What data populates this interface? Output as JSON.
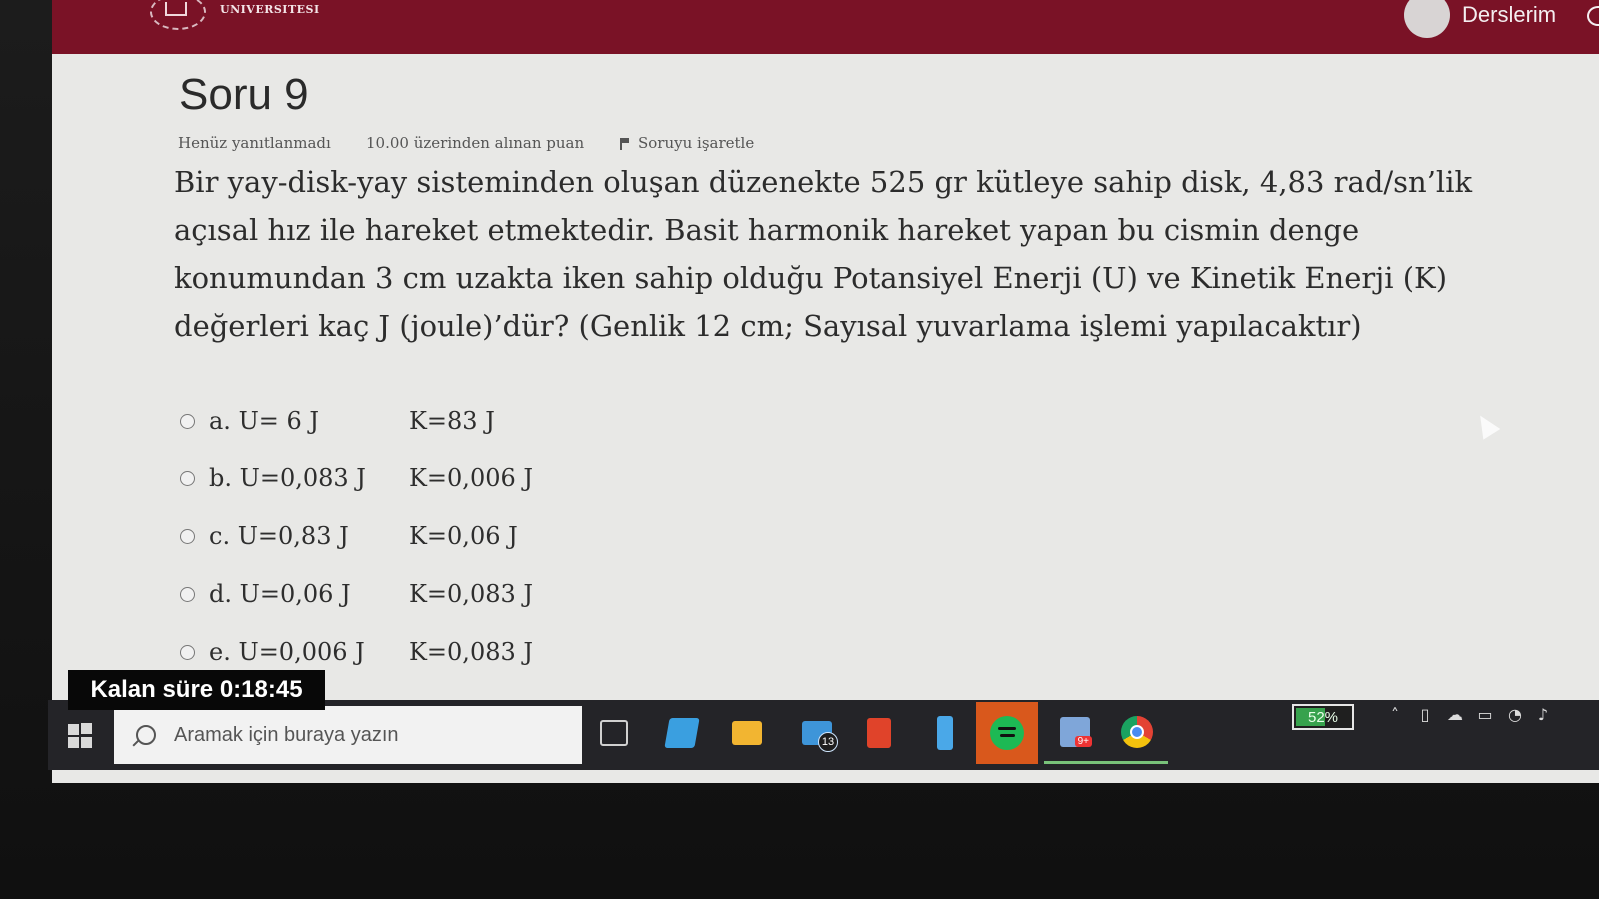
{
  "header": {
    "logo_text": "UNIVERSITESI",
    "nav_link": "Derslerim"
  },
  "question": {
    "title": "Soru 9",
    "state": "Henüz yanıtlanmadı",
    "grade": "10.00 üzerinden alınan puan",
    "flag": "Soruyu işaretle",
    "text": "Bir yay-disk-yay sisteminden oluşan düzenekte 525 gr kütleye sahip disk, 4,83 rad/sn’lik açısal hız ile hareket etmektedir. Basit harmonik hareket yapan bu cismin denge konumundan 3 cm uzakta iken sahip olduğu Potansiyel Enerji (U) ve Kinetik Enerji (K) değerleri kaç J (joule)’dür? (Genlik 12 cm; Sayısal yuvarlama işlemi yapılacaktır)",
    "answers": [
      {
        "u": "a. U= 6 J",
        "k": "K=83 J"
      },
      {
        "u": "b. U=0,083 J",
        "k": "K=0,006 J"
      },
      {
        "u": "c. U=0,83 J",
        "k": "K=0,06 J"
      },
      {
        "u": "d. U=0,06 J",
        "k": "K=0,083 J"
      },
      {
        "u": "e. U=0,006 J",
        "k": "K=0,083 J"
      }
    ]
  },
  "timer": {
    "text": "Kalan süre 0:18:45"
  },
  "taskbar": {
    "search_placeholder": "Aramak için buraya yazın",
    "mail_badge": "13",
    "app_badge": "9+",
    "battery_percent": "52%",
    "battery_level": 0.52,
    "icons": [
      "windows-start-icon",
      "task-view-icon",
      "file-explorer-icon",
      "folder-icon",
      "mail-icon",
      "office-icon",
      "phone-icon",
      "spotify-icon",
      "photos-icon",
      "chrome-icon",
      "battery-icon",
      "chevron-up-icon",
      "usb-icon",
      "cloud-icon",
      "battery-small-icon",
      "wifi-icon",
      "volume-icon"
    ]
  },
  "colors": {
    "header_bg": "#7a1226",
    "page_bg": "#e8e8e6",
    "timer_bg": "#080808",
    "taskbar_bg": "#242428",
    "spotify_tile": "#d9581c",
    "battery_green": "#37a24d"
  }
}
